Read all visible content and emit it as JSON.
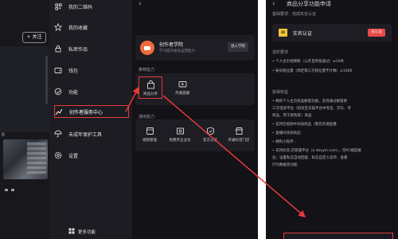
{
  "left_strip": {
    "follow_button": "+ 关注",
    "time_label": "0"
  },
  "menu": {
    "items": [
      {
        "label": "我的二维码",
        "icon": "qr-code-icon"
      },
      {
        "label": "我的收藏",
        "icon": "star-icon"
      },
      {
        "label": "私密作品",
        "icon": "lock-icon"
      },
      {
        "label": "钱包",
        "icon": "wallet-icon"
      },
      {
        "label": "功能",
        "icon": "grid-icon"
      },
      {
        "label": "创作者服务中心",
        "icon": "chart-icon"
      },
      {
        "label": "未成年保护工具",
        "icon": "umbrella-icon"
      },
      {
        "label": "设置",
        "icon": "gear-icon"
      }
    ],
    "more_label": "更多功能",
    "active_index": 5
  },
  "middle": {
    "back_label": "‹",
    "creator": {
      "name": "创作者学院",
      "subtitle": "学习提升账号运营能力",
      "enter_label": "进入学院"
    },
    "recommended_title": "推荐能力",
    "recommended_tools": [
      {
        "label": "商品分享",
        "icon": "shop-bag-icon",
        "highlighted": true
      },
      {
        "label": "开通直播",
        "icon": "live-icon",
        "highlighted": false
      }
    ],
    "general_title": "通用能力",
    "general_tools": [
      {
        "label": "视频管理",
        "icon": "video-icon"
      },
      {
        "label": "免费开企业号",
        "icon": "enterprise-icon"
      },
      {
        "label": "官方认证",
        "icon": "shield-icon"
      },
      {
        "label": "开通抖音门店",
        "icon": "store-icon"
      }
    ]
  },
  "right": {
    "back_label": "‹",
    "header": "商品分享功能申请",
    "subheader": "基础要求：完成实名认证",
    "verify": {
      "icon_text": "ID",
      "label": "实名认证",
      "button": "去认证"
    },
    "progress_title": "进阶要求",
    "progress_lines": [
      "• 个人主页视频数（公开且审核通过）≥10条",
      "• 账号粉丝量（绑定第三方粉丝量不计数）≥1000"
    ],
    "benefits_title": "获得权益",
    "benefit_lines": [
      "• 拥有个人主页商品橱窗功能，支持通过橱窗更",
      "  三方电商平台（如淘宝天猫平台中淘宝、京东、考",
      "  商品、苏宁易购等）商品",
      "• 支持在视频中添加商品（需先开通直播",
      "• 直播间添加商品",
      "• 拥有小程序...",
      "• 支持抖音·店管理平台（e.douyin.com），可PC端后端",
      "  台，设置私信自动回复、私信自定义菜单、查看",
      "  行为数据等功能"
    ]
  }
}
